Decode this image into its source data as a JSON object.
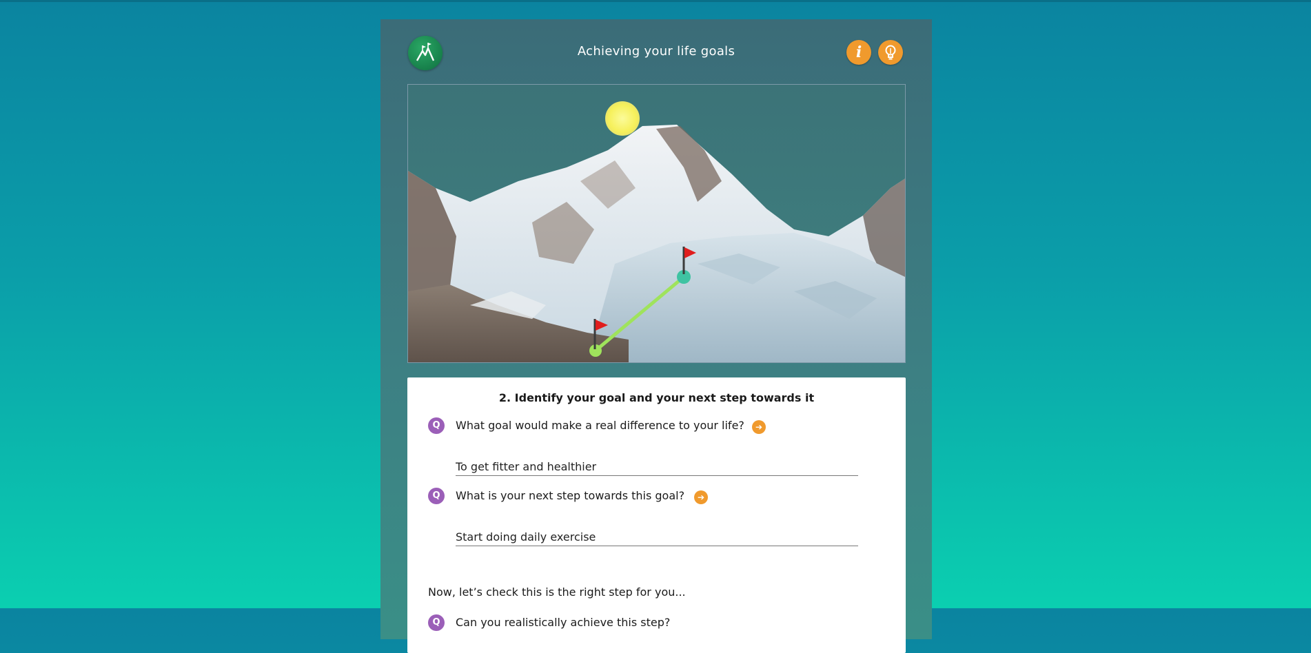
{
  "header": {
    "title": "Achieving your life goals",
    "logo_icon": "mountain-flags-icon",
    "info_icon": "info-icon",
    "tip_icon": "lightbulb-icon",
    "info_glyph": "i"
  },
  "colors": {
    "accent_orange": "#f09a2d",
    "question_purple": "#9b5fb8",
    "path_green": "#9fe35c",
    "milestone_teal": "#3fc3a2",
    "flag_red": "#e01d1d",
    "sun_yellow": "#f7f36a"
  },
  "scene": {
    "description_icons": [
      "sun-icon",
      "flag-icon",
      "flag-icon"
    ],
    "progress_steps_completed": 1,
    "progress_steps_visible": 2
  },
  "section": {
    "title": "2. Identify your goal and your next step towards it",
    "questions": [
      {
        "badge": "Q",
        "text": "What goal would make a real difference to your life?",
        "answer": "To get fitter and healthier",
        "next_glyph": "➔"
      },
      {
        "badge": "Q",
        "text": "What is your next step towards this goal?",
        "answer": "Start doing daily exercise",
        "next_glyph": "➔"
      },
      {
        "badge": "Q",
        "text": "Can you realistically achieve this step?"
      }
    ],
    "check_prompt": "Now, let’s check this is the right step for you..."
  }
}
